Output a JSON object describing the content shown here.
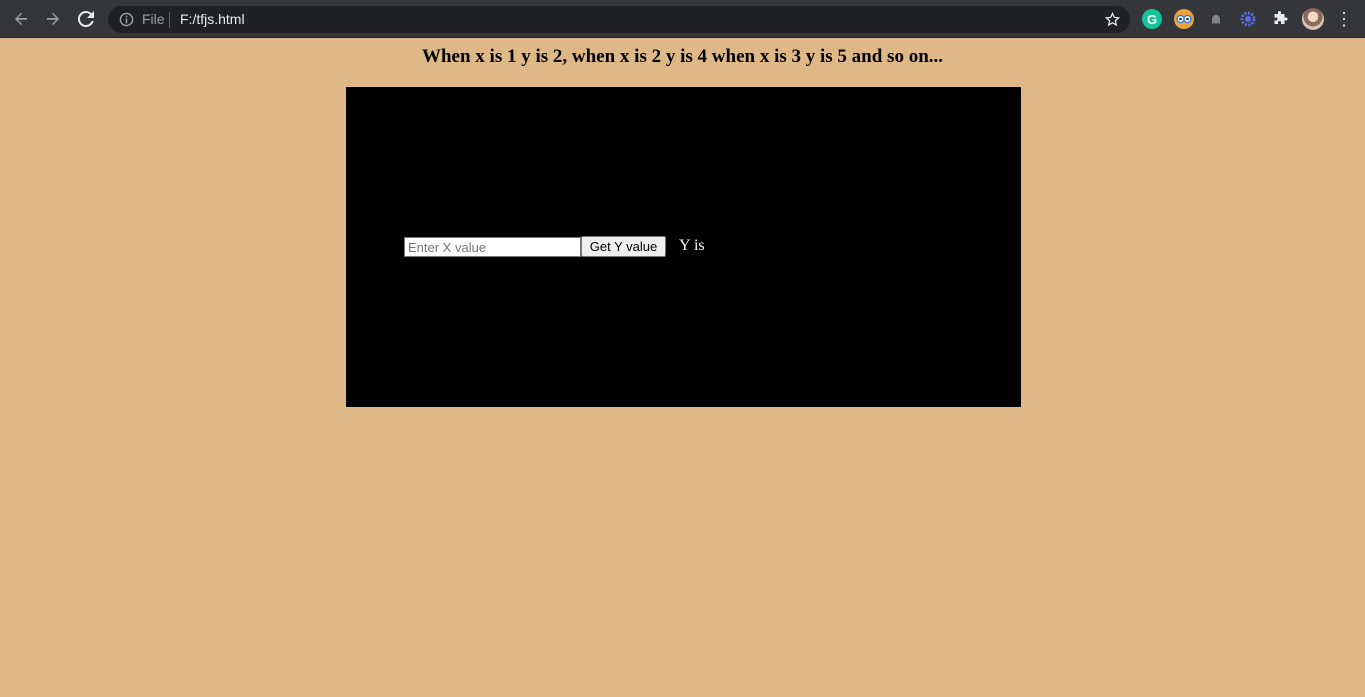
{
  "browser": {
    "scheme_label": "File",
    "url": "F:/tfjs.html",
    "icons": [
      "back-arrow-icon",
      "forward-arrow-icon",
      "reload-icon",
      "info-icon",
      "star-icon",
      "grammarly-icon",
      "owl-extension-icon",
      "ghost-extension-icon",
      "gear-extension-icon",
      "puzzle-extensions-icon",
      "profile-avatar",
      "kebab-menu-icon"
    ],
    "grammarly_letter": "G",
    "menu_glyph": "⋮"
  },
  "page": {
    "heading": "When x is 1 y is 2, when x is 2 y is 4 when x is 3 y is 5 and so on...",
    "x_input": {
      "placeholder": "Enter X value",
      "value": ""
    },
    "get_button_label": "Get Y value",
    "y_output_label": "Y is"
  },
  "colors": {
    "page_background": "#DEB887",
    "panel_background": "#000000",
    "chrome_background": "#35363A"
  }
}
